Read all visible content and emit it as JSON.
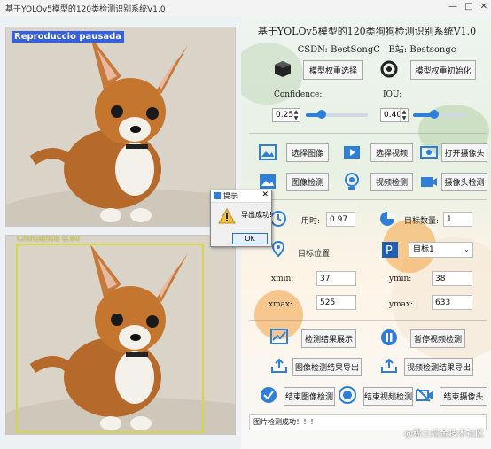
{
  "window": {
    "title": "基于YOLOv5模型的120类检测识别系统V1.0",
    "overlay_label": "Reproduccio pausada",
    "controls": [
      "—",
      "□",
      "✕"
    ]
  },
  "detection_overlay": {
    "label": "Chihuahua 0.80",
    "color": "#d6d64a"
  },
  "header": {
    "title": "基于YOLOv5模型的120类狗狗检测识别系统V1.0",
    "csdn_label": "CSDN:",
    "csdn_value": "BestSongC",
    "bilibili_label": "B站:",
    "bilibili_value": "Bestsongc"
  },
  "model": {
    "select_label": "模型权重选择",
    "init_label": "模型权重初始化"
  },
  "thresholds": {
    "confidence_label": "Confidence:",
    "confidence_value": "0.25",
    "confidence_fraction": 0.25,
    "iou_label": "IOU:",
    "iou_value": "0.40",
    "iou_fraction": 0.4
  },
  "actions": {
    "select_image": "选择图像",
    "select_video": "选择视频",
    "open_camera": "打开摄像头",
    "image_detect": "图像检测",
    "video_detect": "视频检测",
    "camera_detect": "摄像头检测"
  },
  "results": {
    "time_label": "用时:",
    "time_value": "0.97",
    "count_label": "目标数量:",
    "count_value": "1",
    "position_label": "目标位置:",
    "target_select": "目标1",
    "xmin_label": "xmin:",
    "xmin_value": "37",
    "ymin_label": "ymin:",
    "ymin_value": "38",
    "xmax_label": "xmax:",
    "xmax_value": "525",
    "ymax_label": "ymax:",
    "ymax_value": "633"
  },
  "bottom_actions": {
    "show_results": "检测结果展示",
    "pause_video": "暂停视频检测",
    "export_image": "图像检测结果导出",
    "export_video": "视频检测结果导出",
    "end_image": "结束图像检测",
    "end_video": "结束视频检测",
    "end_camera": "结束摄像头"
  },
  "dialog": {
    "title": "提示",
    "message": "导出成功!",
    "ok": "OK",
    "close": "✕"
  },
  "status": {
    "text": "图片检测成功！！！"
  },
  "watermark": "@稀土掘金技术社区",
  "colors": {
    "accent": "#2f7fd8",
    "dark_icon": "#1f2d3d"
  }
}
